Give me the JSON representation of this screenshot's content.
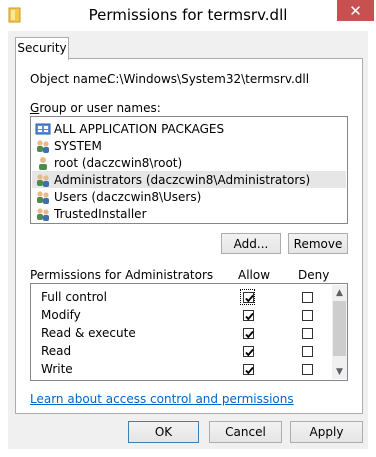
{
  "window": {
    "title": "Permissions for termsrv.dll",
    "close_glyph": "✕"
  },
  "tabs": [
    {
      "label": "Security"
    }
  ],
  "object": {
    "label": "Object name:",
    "value": "C:\\Windows\\System32\\termsrv.dll"
  },
  "groups": {
    "label": "Group or user names:",
    "items": [
      {
        "label": "ALL APPLICATION PACKAGES",
        "icon": "app-packages-icon"
      },
      {
        "label": "SYSTEM",
        "icon": "group-icon"
      },
      {
        "label": "root (daczcwin8\\root)",
        "icon": "user-icon"
      },
      {
        "label": "Administrators (daczcwin8\\Administrators)",
        "icon": "group-icon",
        "selected": true
      },
      {
        "label": "Users (daczcwin8\\Users)",
        "icon": "group-icon"
      },
      {
        "label": "TrustedInstaller",
        "icon": "group-icon"
      }
    ]
  },
  "buttons": {
    "add": "Add...",
    "remove": "Remove",
    "ok": "OK",
    "cancel": "Cancel",
    "apply": "Apply"
  },
  "permissions": {
    "label": "Permissions for Administrators",
    "allow_header": "Allow",
    "deny_header": "Deny",
    "rows": [
      {
        "name": "Full control",
        "allow": true,
        "deny": false
      },
      {
        "name": "Modify",
        "allow": true,
        "deny": false
      },
      {
        "name": "Read & execute",
        "allow": true,
        "deny": false
      },
      {
        "name": "Read",
        "allow": true,
        "deny": false
      },
      {
        "name": "Write",
        "allow": true,
        "deny": false
      }
    ]
  },
  "link": {
    "text": "Learn about access control and permissions"
  }
}
